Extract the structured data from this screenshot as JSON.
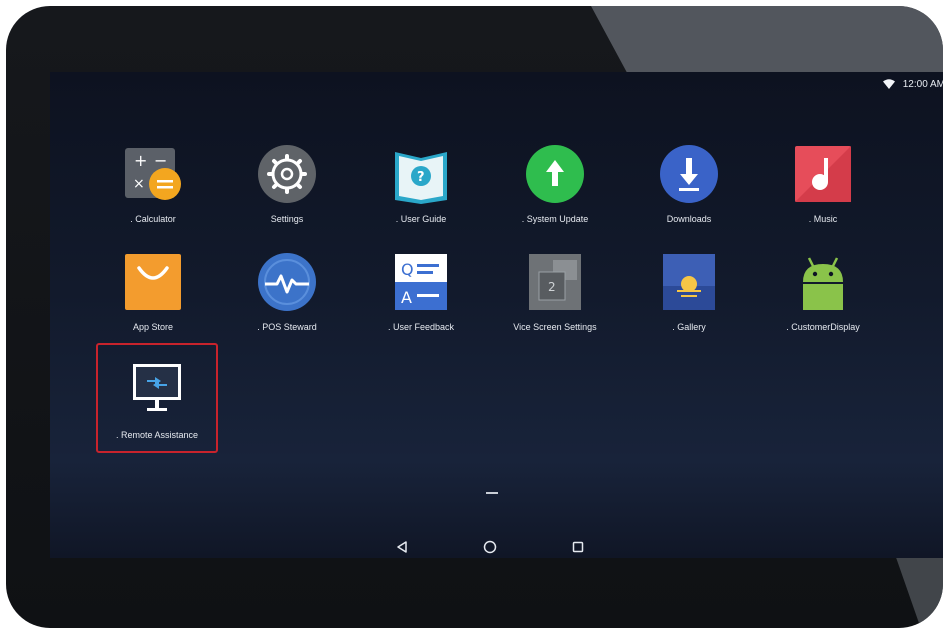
{
  "status_bar": {
    "time": "12:00 AM",
    "wifi_icon": "wifi-icon"
  },
  "apps": [
    {
      "id": "calculator",
      "label": ". Calculator",
      "icon": "calculator-icon"
    },
    {
      "id": "settings",
      "label": "Settings",
      "icon": "gear-icon"
    },
    {
      "id": "user-guide",
      "label": ". User Guide",
      "icon": "book-icon"
    },
    {
      "id": "system-update",
      "label": ". System Update",
      "icon": "arrow-up-icon"
    },
    {
      "id": "downloads",
      "label": "Downloads",
      "icon": "download-icon"
    },
    {
      "id": "music",
      "label": ". Music",
      "icon": "music-icon"
    },
    {
      "id": "app-store",
      "label": "App Store",
      "icon": "shopping-bag-icon"
    },
    {
      "id": "pos-steward",
      "label": ". POS Steward",
      "icon": "heartbeat-icon"
    },
    {
      "id": "user-feedback",
      "label": ". User Feedback",
      "icon": "qa-icon"
    },
    {
      "id": "vice-screen-settings",
      "label": "Vice Screen Settings",
      "icon": "dual-screen-icon"
    },
    {
      "id": "gallery",
      "label": ". Gallery",
      "icon": "gallery-icon"
    },
    {
      "id": "customer-display",
      "label": ". CustomerDisplay",
      "icon": "android-icon"
    },
    {
      "id": "remote-assistance",
      "label": ". Remote Assistance",
      "icon": "monitor-transfer-icon"
    }
  ],
  "highlighted_app": "remote-assistance",
  "highlight_color": "#c8232c",
  "nav": {
    "back_icon": "back-triangle-icon",
    "home_icon": "home-circle-icon",
    "recents_icon": "recents-square-icon"
  }
}
